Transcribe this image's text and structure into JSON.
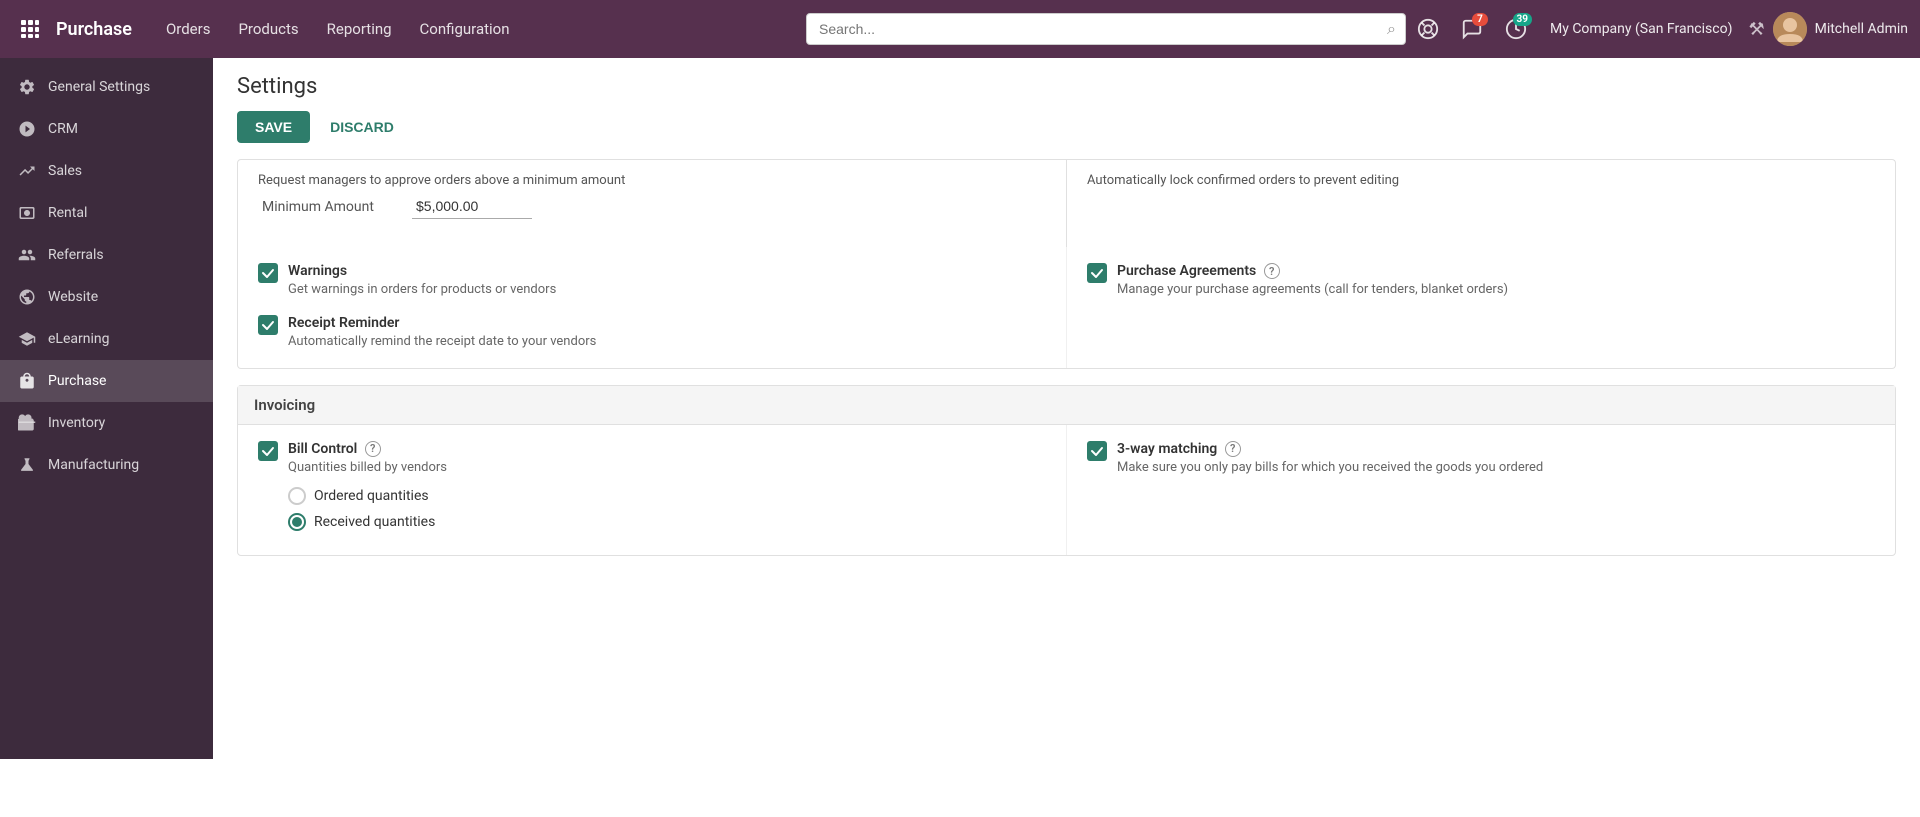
{
  "topnav": {
    "brand": "Purchase",
    "links": [
      "Orders",
      "Products",
      "Reporting",
      "Configuration"
    ],
    "search_placeholder": "Search...",
    "notification_count": "7",
    "activity_count": "39",
    "company": "My Company (San Francisco)",
    "username": "Mitchell Admin"
  },
  "sidebar": {
    "items": [
      {
        "id": "general-settings",
        "label": "General Settings",
        "icon": "gear"
      },
      {
        "id": "crm",
        "label": "CRM",
        "icon": "crm"
      },
      {
        "id": "sales",
        "label": "Sales",
        "icon": "sales"
      },
      {
        "id": "rental",
        "label": "Rental",
        "icon": "rental"
      },
      {
        "id": "referrals",
        "label": "Referrals",
        "icon": "referrals"
      },
      {
        "id": "website",
        "label": "Website",
        "icon": "website"
      },
      {
        "id": "elearning",
        "label": "eLearning",
        "icon": "elearning"
      },
      {
        "id": "purchase",
        "label": "Purchase",
        "icon": "purchase",
        "active": true
      },
      {
        "id": "inventory",
        "label": "Inventory",
        "icon": "inventory"
      },
      {
        "id": "manufacturing",
        "label": "Manufacturing",
        "icon": "manufacturing"
      }
    ]
  },
  "page": {
    "title": "Settings",
    "save_label": "SAVE",
    "discard_label": "DISCARD"
  },
  "partial_top": {
    "left_text": "Request managers to approve orders above a minimum amount",
    "right_text": "Automatically lock confirmed orders to prevent editing",
    "minimum_amount_label": "Minimum Amount",
    "minimum_amount_value": "$5,000.00"
  },
  "orders_section": {
    "left": [
      {
        "id": "warnings",
        "label": "Warnings",
        "description": "Get warnings in orders for products or vendors",
        "checked": true
      },
      {
        "id": "receipt-reminder",
        "label": "Receipt Reminder",
        "description": "Automatically remind the receipt date to your vendors",
        "checked": true
      }
    ],
    "right": [
      {
        "id": "purchase-agreements",
        "label": "Purchase Agreements",
        "help": true,
        "description": "Manage your purchase agreements (call for tenders, blanket orders)",
        "checked": true
      }
    ]
  },
  "invoicing_section": {
    "header": "Invoicing",
    "left": {
      "id": "bill-control",
      "label": "Bill Control",
      "help": true,
      "description": "Quantities billed by vendors",
      "radio_options": [
        {
          "id": "ordered-quantities",
          "label": "Ordered quantities",
          "selected": false
        },
        {
          "id": "received-quantities",
          "label": "Received quantities",
          "selected": true
        }
      ]
    },
    "right": {
      "id": "three-way-matching",
      "label": "3-way matching",
      "help": true,
      "description": "Make sure you only pay bills for which you received the goods you ordered",
      "checked": true
    }
  }
}
